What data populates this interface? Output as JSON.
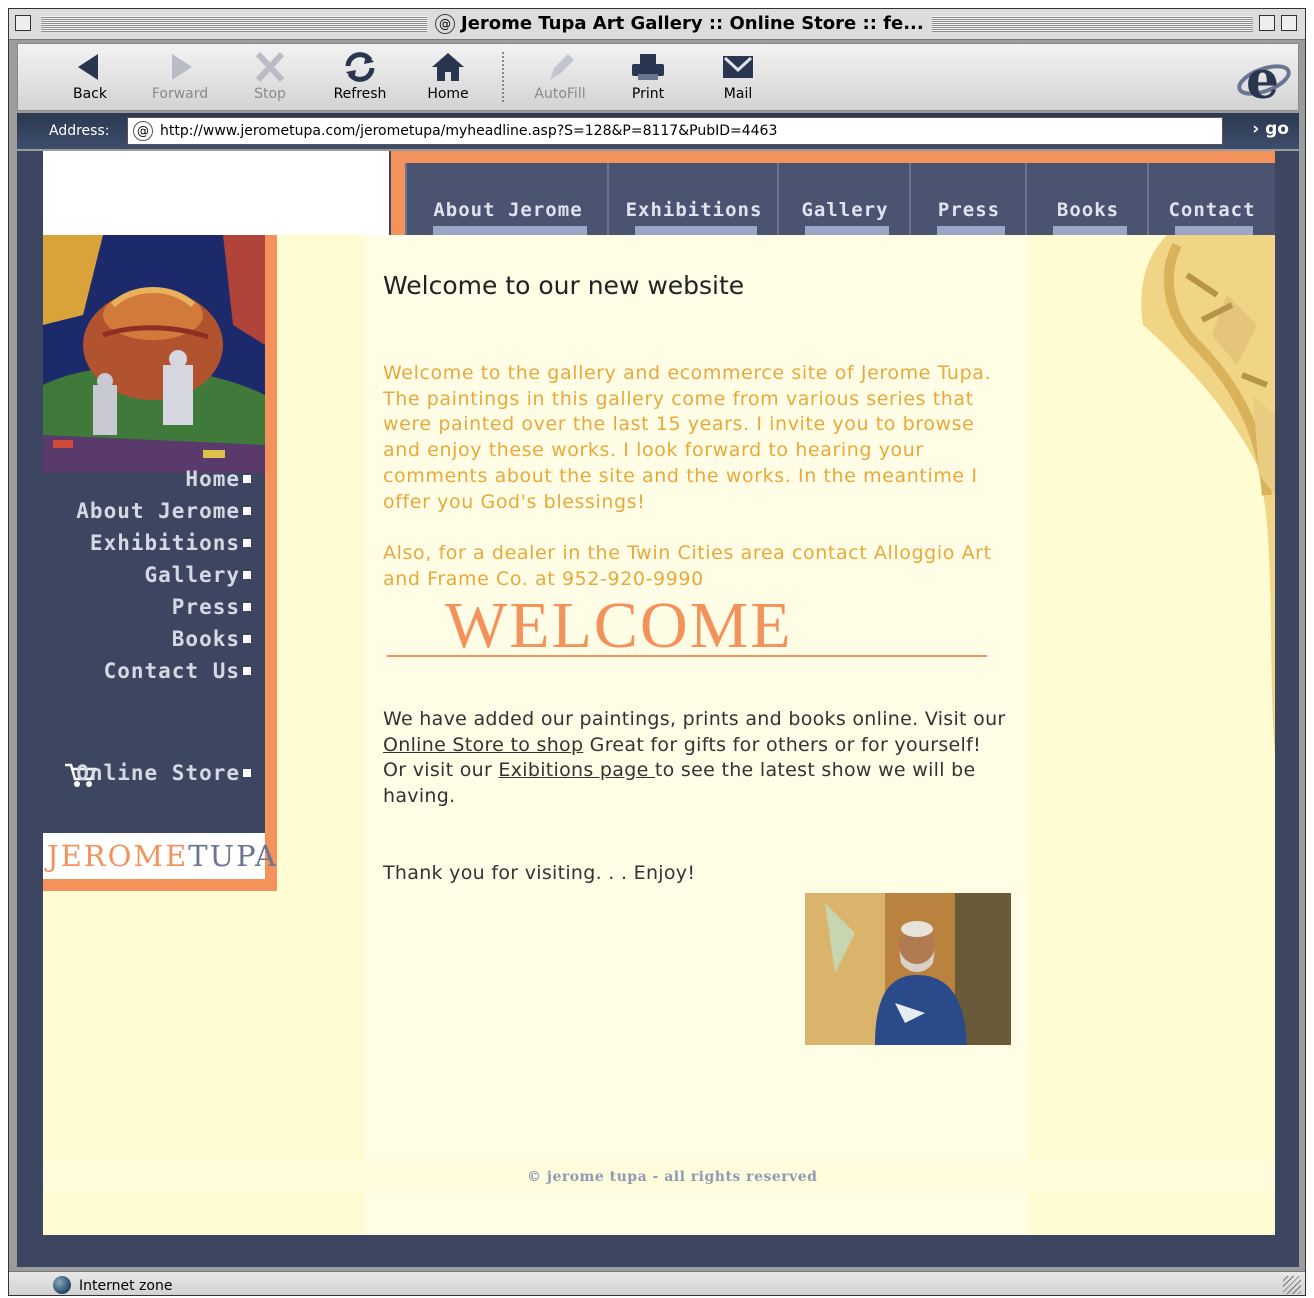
{
  "window": {
    "title": "Jerome Tupa Art Gallery :: Online Store :: fe..."
  },
  "toolbar": {
    "back": "Back",
    "forward": "Forward",
    "stop": "Stop",
    "refresh": "Refresh",
    "home": "Home",
    "autofill": "AutoFill",
    "print": "Print",
    "mail": "Mail"
  },
  "address": {
    "label": "Address:",
    "url": "http://www.jerometupa.com/jerometupa/myheadline.asp?S=128&P=8117&PubID=4463",
    "go": "go"
  },
  "topnav": {
    "tabs": [
      {
        "label": "About Jerome"
      },
      {
        "label": "Exhibitions"
      },
      {
        "label": "Gallery"
      },
      {
        "label": "Press"
      },
      {
        "label": "Books"
      },
      {
        "label": "Contact"
      }
    ]
  },
  "sidenav": {
    "items": [
      {
        "label": "Home"
      },
      {
        "label": "About Jerome"
      },
      {
        "label": "Exhibitions"
      },
      {
        "label": "Gallery"
      },
      {
        "label": "Press"
      },
      {
        "label": "Books"
      },
      {
        "label": "Contact Us"
      }
    ],
    "store": "Online Store"
  },
  "logo": {
    "first": "JEROME",
    "last": "TUPA"
  },
  "main": {
    "heading": "Welcome to our new website",
    "intro": "Welcome to the gallery and ecommerce site of Jerome Tupa. The paintings in this gallery come from various series that were painted over the last 15 years. I invite you to browse and enjoy these works. I look forward to hearing your comments about the site and the works. In the meantime I offer you God's blessings!",
    "dealer": "Also, for a dealer in the Twin Cities area contact Alloggio Art and Frame Co. at 952-920-9990",
    "welcome_banner": "WELCOME",
    "p1_a": "We have added our paintings, prints and books online. Visit our ",
    "p1_link": "Online Store to shop",
    "p1_b": " Great for gifts for others or for yourself!",
    "p2_a": "Or visit our ",
    "p2_link": "Exibitions page ",
    "p2_b": " to see the latest show we will be having.",
    "thanks": "Thank you for visiting. . . Enjoy!",
    "copyright": "© jerome tupa - all rights reserved"
  },
  "status": {
    "zone": "Internet zone"
  },
  "colors": {
    "accent_orange": "#f4925c",
    "nav_navy": "#4a5370",
    "page_cream": "#fffbd2",
    "intro_gold": "#e8a93c"
  }
}
